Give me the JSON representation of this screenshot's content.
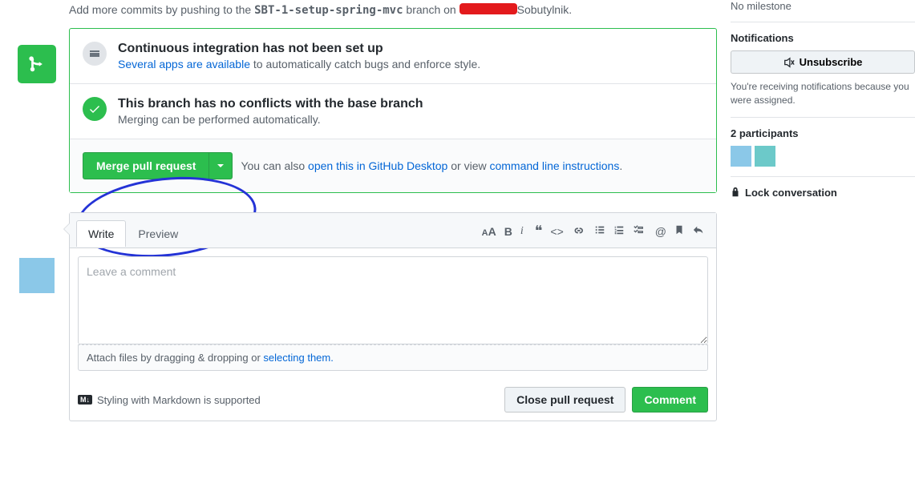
{
  "hint": {
    "prefix": "Add more commits by pushing to the ",
    "branch": "SBT-1-setup-spring-mvc",
    "mid": " branch on ",
    "repo_suffix": "Sobutylnik."
  },
  "ci": {
    "title": "Continuous integration has not been set up",
    "link": "Several apps are available",
    "suffix": " to automatically catch bugs and enforce style."
  },
  "conf": {
    "title": "This branch has no conflicts with the base branch",
    "sub": "Merging can be performed automatically."
  },
  "merge": {
    "btn": "Merge pull request",
    "also_prefix": "You can also ",
    "desktop_link": "open this in GitHub Desktop",
    "mid": " or view ",
    "cli_link": "command line instructions",
    "end": "."
  },
  "tabs": {
    "write": "Write",
    "preview": "Preview"
  },
  "comment": {
    "placeholder": "Leave a comment",
    "attach_prefix": "Attach files by dragging & dropping or ",
    "attach_link": "selecting them.",
    "md_hint": "Styling with Markdown is supported",
    "md_badge": "M↓",
    "close_btn": "Close pull request",
    "comment_btn": "Comment"
  },
  "sidebar": {
    "milestone": "No milestone",
    "notif_title": "Notifications",
    "unsubscribe": "Unsubscribe",
    "notif_note": "You're receiving notifications because you were assigned.",
    "participants_label": "2 participants",
    "lock": "Lock conversation"
  }
}
